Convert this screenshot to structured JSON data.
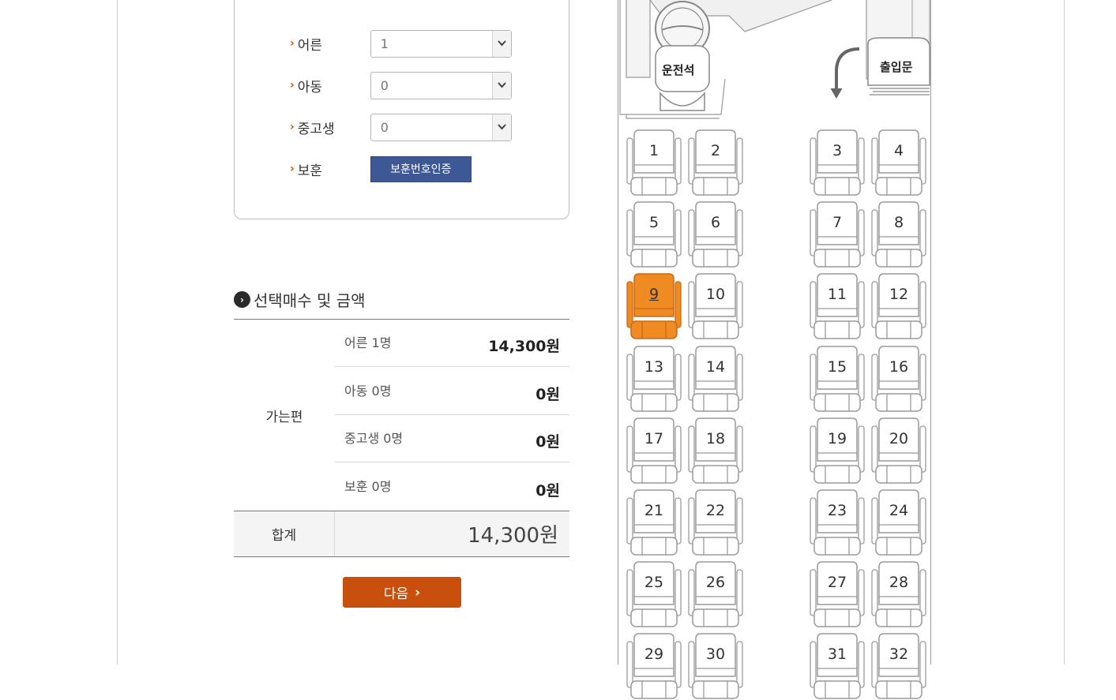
{
  "passenger_counts": {
    "adult": {
      "label": "어른",
      "value": "1"
    },
    "child": {
      "label": "아동",
      "value": "0"
    },
    "student": {
      "label": "중고생",
      "value": "0"
    },
    "veteran": {
      "label": "보훈",
      "button": "보훈번호인증"
    }
  },
  "summary": {
    "title": "선택매수 및 금액",
    "trip_label": "가는편",
    "rows": [
      {
        "label": "어른 1명",
        "amount": "14,300원"
      },
      {
        "label": "아동 0명",
        "amount": "0원"
      },
      {
        "label": "중고생 0명",
        "amount": "0원"
      },
      {
        "label": "보훈 0명",
        "amount": "0원"
      }
    ],
    "total_label": "합계",
    "total_amount": "14,300원"
  },
  "next_button": "다음",
  "bus": {
    "driver_label": "운전석",
    "door_label": "출입문",
    "selected_seat": "9",
    "seats": [
      "1",
      "2",
      "3",
      "4",
      "5",
      "6",
      "7",
      "8",
      "9",
      "10",
      "11",
      "12",
      "13",
      "14",
      "15",
      "16",
      "17",
      "18",
      "19",
      "20",
      "21",
      "22",
      "23",
      "24",
      "25",
      "26",
      "27",
      "28",
      "29",
      "30",
      "31",
      "32"
    ]
  },
  "colors": {
    "selected_seat": "#f08a23",
    "next_button": "#c94f0c",
    "merit_button": "#3e5895"
  }
}
